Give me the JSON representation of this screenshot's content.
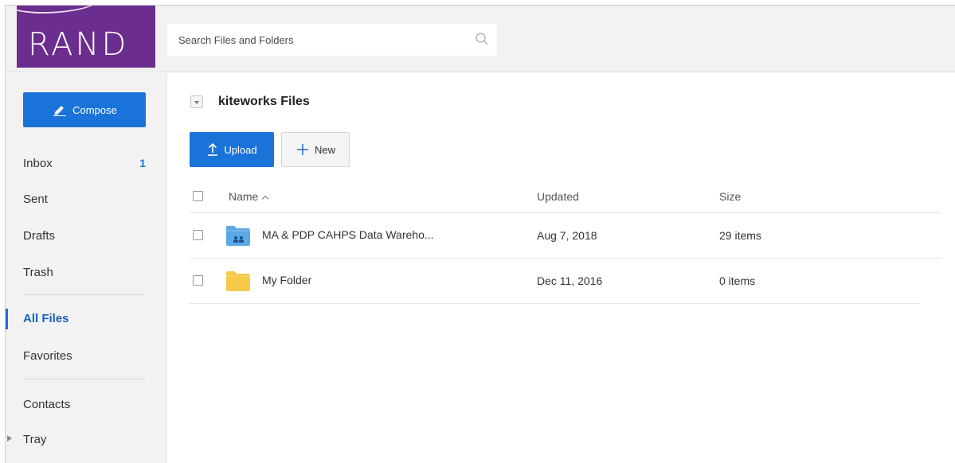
{
  "brand": {
    "logo_text": "RAND",
    "color": "#6b2d8e"
  },
  "search": {
    "placeholder": "Search Files and Folders",
    "icon": "search-icon"
  },
  "sidebar": {
    "compose_label": "Compose",
    "items": [
      {
        "label": "Inbox",
        "count": "1"
      },
      {
        "label": "Sent"
      },
      {
        "label": "Drafts"
      },
      {
        "label": "Trash"
      },
      {
        "label": "All Files",
        "active": true
      },
      {
        "label": "Favorites"
      },
      {
        "label": "Contacts"
      },
      {
        "label": "Tray"
      }
    ]
  },
  "main": {
    "title": "kiteworks Files",
    "upload_label": "Upload",
    "new_label": "New",
    "columns": {
      "name": "Name",
      "updated": "Updated",
      "size": "Size"
    },
    "rows": [
      {
        "name": "MA & PDP CAHPS Data Wareho...",
        "updated": "Aug 7, 2018",
        "size": "29 items",
        "icon": "shared-folder-icon"
      },
      {
        "name": "My Folder",
        "updated": "Dec 11, 2016",
        "size": "0 items",
        "icon": "folder-icon"
      }
    ]
  },
  "colors": {
    "accent": "#1a73d9",
    "folder": "#f7c948",
    "shared_folder": "#5aa9e6"
  }
}
